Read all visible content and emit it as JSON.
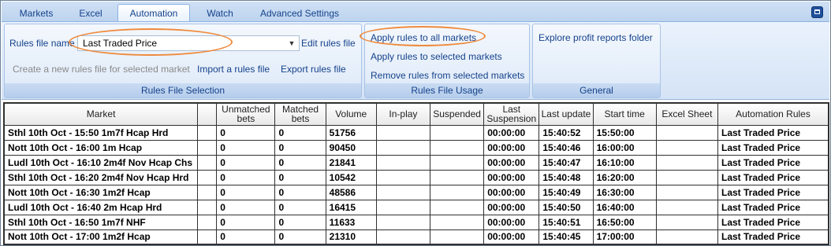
{
  "tabs": [
    "Markets",
    "Excel",
    "Automation",
    "Watch",
    "Advanced Settings"
  ],
  "active_tab": "Automation",
  "rules_file_selection": {
    "rules_file_name_label": "Rules file name",
    "rules_file_value": "Last Traded Price",
    "edit_rules_file": "Edit rules file",
    "create_new_rules_file": "Create a new rules file for selected market",
    "import_rules_file": "Import a rules file",
    "export_rules_file": "Export rules file",
    "group_label": "Rules File Selection"
  },
  "rules_file_usage": {
    "apply_all": "Apply rules to all markets",
    "apply_selected": "Apply rules to selected markets",
    "remove_selected": "Remove rules from selected markets",
    "group_label": "Rules File Usage"
  },
  "general": {
    "explore_profit": "Explore profit reports folder",
    "group_label": "General"
  },
  "grid": {
    "columns": [
      "Market",
      "",
      "Unmatched bets",
      "Matched bets",
      "Volume",
      "In-play",
      "Suspended",
      "Last Suspension",
      "Last update",
      "Start time",
      "Excel Sheet",
      "Automation Rules"
    ],
    "rows": [
      [
        "Sthl 10th Oct - 15:50 1m7f Hcap Hrd",
        "",
        "0",
        "0",
        "51756",
        "",
        "",
        "00:00:00",
        "15:40:52",
        "15:50:00",
        "",
        "Last Traded Price"
      ],
      [
        "Nott 10th Oct - 16:00 1m Hcap",
        "",
        "0",
        "0",
        "90450",
        "",
        "",
        "00:00:00",
        "15:40:46",
        "16:00:00",
        "",
        "Last Traded Price"
      ],
      [
        "Ludl 10th Oct - 16:10 2m4f Nov Hcap Chs",
        "",
        "0",
        "0",
        "21841",
        "",
        "",
        "00:00:00",
        "15:40:47",
        "16:10:00",
        "",
        "Last Traded Price"
      ],
      [
        "Sthl 10th Oct - 16:20 2m4f Nov Hcap Hrd",
        "",
        "0",
        "0",
        "10542",
        "",
        "",
        "00:00:00",
        "15:40:48",
        "16:20:00",
        "",
        "Last Traded Price"
      ],
      [
        "Nott 10th Oct - 16:30 1m2f Hcap",
        "",
        "0",
        "0",
        "48586",
        "",
        "",
        "00:00:00",
        "15:40:49",
        "16:30:00",
        "",
        "Last Traded Price"
      ],
      [
        "Ludl 10th Oct - 16:40 2m Hcap Hrd",
        "",
        "0",
        "0",
        "16415",
        "",
        "",
        "00:00:00",
        "15:40:50",
        "16:40:00",
        "",
        "Last Traded Price"
      ],
      [
        "Sthl 10th Oct - 16:50 1m7f NHF",
        "",
        "0",
        "0",
        "11633",
        "",
        "",
        "00:00:00",
        "15:40:51",
        "16:50:00",
        "",
        "Last Traded Price"
      ],
      [
        "Nott 10th Oct - 17:00 1m2f Hcap",
        "",
        "0",
        "0",
        "21310",
        "",
        "",
        "00:00:00",
        "15:40:45",
        "17:00:00",
        "",
        "Last Traded Price"
      ]
    ]
  },
  "colors": {
    "highlight_ellipse": "#ef8a3c",
    "ribbon_text": "#15428b"
  }
}
